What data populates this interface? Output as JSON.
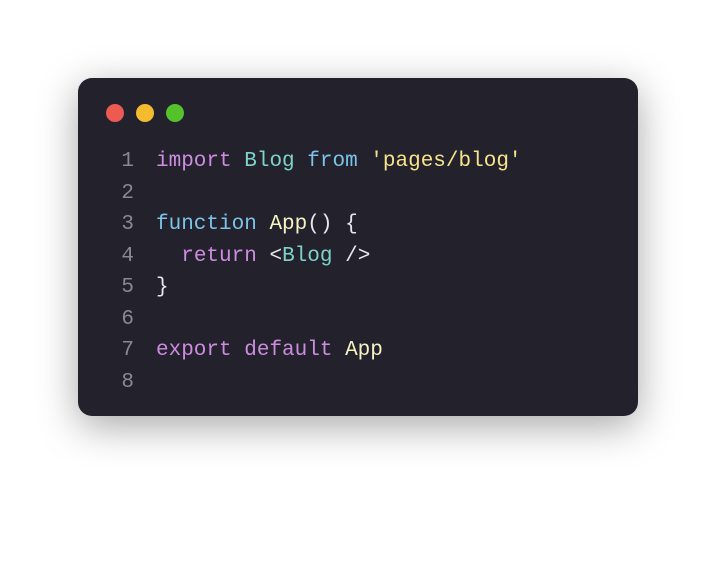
{
  "window": {
    "dots": [
      "red",
      "yellow",
      "green"
    ]
  },
  "code": {
    "lines": [
      {
        "n": "1",
        "tokens": [
          {
            "cls": "tok-key",
            "t": "import"
          },
          {
            "cls": "tok-default",
            "t": " "
          },
          {
            "cls": "tok-class",
            "t": "Blog"
          },
          {
            "cls": "tok-default",
            "t": " "
          },
          {
            "cls": "tok-from2",
            "t": "from"
          },
          {
            "cls": "tok-default",
            "t": " "
          },
          {
            "cls": "tok-str",
            "t": "'pages/blog'"
          }
        ]
      },
      {
        "n": "2",
        "tokens": []
      },
      {
        "n": "3",
        "tokens": [
          {
            "cls": "tok-from2",
            "t": "function"
          },
          {
            "cls": "tok-default",
            "t": " "
          },
          {
            "cls": "tok-fnname",
            "t": "App"
          },
          {
            "cls": "tok-punc",
            "t": "()"
          },
          {
            "cls": "tok-default",
            "t": " "
          },
          {
            "cls": "tok-punc",
            "t": "{"
          }
        ]
      },
      {
        "n": "4",
        "tokens": [
          {
            "cls": "tok-default",
            "t": "  "
          },
          {
            "cls": "tok-key",
            "t": "return"
          },
          {
            "cls": "tok-default",
            "t": " "
          },
          {
            "cls": "tok-punc",
            "t": "<"
          },
          {
            "cls": "tok-class",
            "t": "Blog"
          },
          {
            "cls": "tok-default",
            "t": " "
          },
          {
            "cls": "tok-punc",
            "t": "/>"
          }
        ]
      },
      {
        "n": "5",
        "tokens": [
          {
            "cls": "tok-punc",
            "t": "}"
          }
        ]
      },
      {
        "n": "6",
        "tokens": []
      },
      {
        "n": "7",
        "tokens": [
          {
            "cls": "tok-key",
            "t": "export"
          },
          {
            "cls": "tok-default",
            "t": " "
          },
          {
            "cls": "tok-key",
            "t": "default"
          },
          {
            "cls": "tok-default",
            "t": " "
          },
          {
            "cls": "tok-fnname",
            "t": "App"
          }
        ]
      },
      {
        "n": "8",
        "tokens": []
      }
    ]
  }
}
